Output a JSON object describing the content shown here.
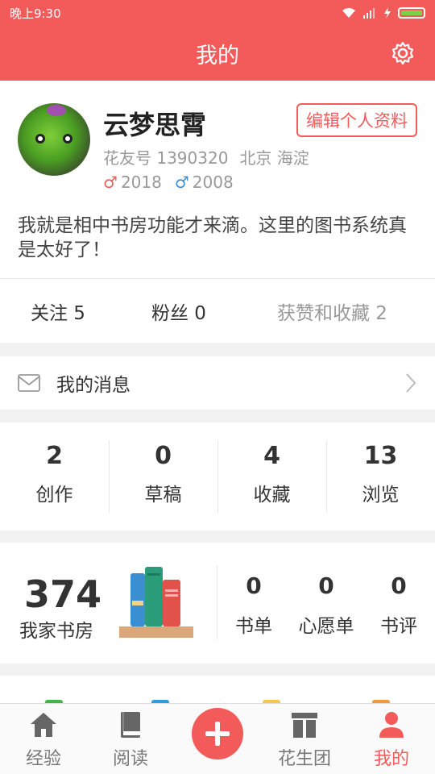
{
  "status_bar": {
    "time": "晚上9:30"
  },
  "header": {
    "title": "我的"
  },
  "profile": {
    "username": "云梦思霄",
    "edit_label": "编辑个人资料",
    "id_text": "花友号 1390320",
    "location": "北京 海淀",
    "female_symbol": "♂",
    "female_year": "2018",
    "male_symbol": "♂",
    "male_year": "2008",
    "bio": "我就是相中书房功能才来滴。这里的图书系统真是太好了！",
    "follow": "关注 5",
    "fans": "粉丝 0",
    "likes": "获赞和收藏 2"
  },
  "messages": {
    "label": "我的消息"
  },
  "stats": [
    {
      "value": "2",
      "label": "创作"
    },
    {
      "value": "0",
      "label": "草稿"
    },
    {
      "value": "4",
      "label": "收藏"
    },
    {
      "value": "13",
      "label": "浏览"
    }
  ],
  "study": {
    "count": "374",
    "label": "我家书房",
    "items": [
      {
        "value": "0",
        "label": "书单"
      },
      {
        "value": "0",
        "label": "心愿单"
      },
      {
        "value": "0",
        "label": "书评"
      }
    ]
  },
  "tabs": [
    {
      "label": "经验",
      "icon": "home-icon"
    },
    {
      "label": "阅读",
      "icon": "book-icon"
    },
    {
      "label": "",
      "icon": "plus-icon"
    },
    {
      "label": "花生团",
      "icon": "group-icon"
    },
    {
      "label": "我的",
      "icon": "person-icon"
    }
  ],
  "colors": {
    "accent": "#f35b5b",
    "male": "#3a8fd8"
  }
}
